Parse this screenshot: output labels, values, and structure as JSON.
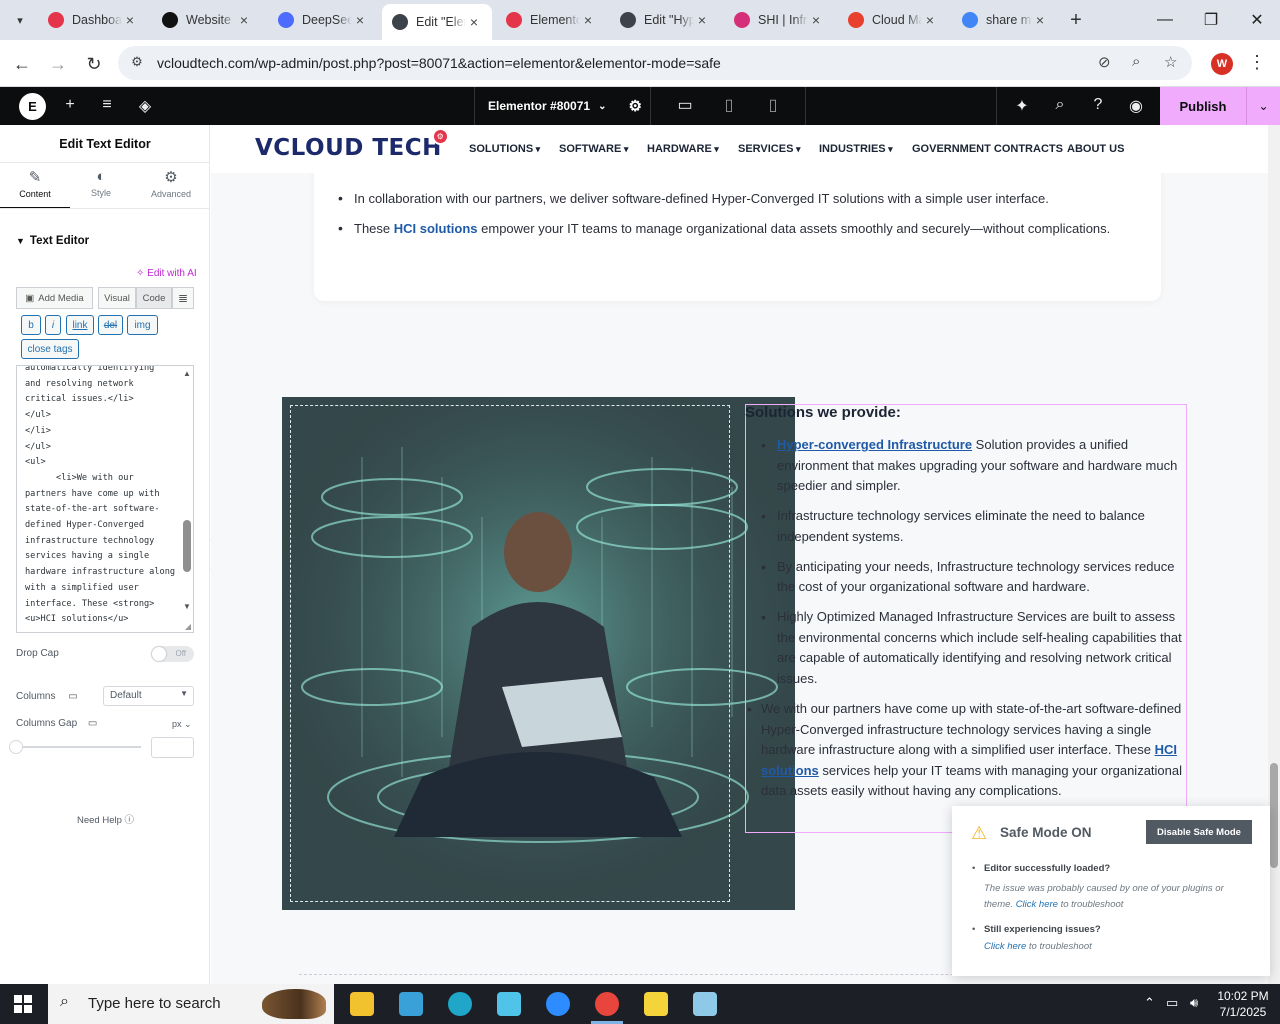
{
  "browser": {
    "tabs": [
      {
        "label": "Dashboard",
        "icon": "gear-red-icon",
        "color": "#e4354b",
        "active": false
      },
      {
        "label": "Website",
        "icon": "openai-icon",
        "color": "#111111",
        "active": false
      },
      {
        "label": "DeepSeek",
        "icon": "deepseek-icon",
        "color": "#4d6bfe",
        "active": false
      },
      {
        "label": "Edit \"Elementor",
        "icon": "wordpress-icon",
        "color": "#3c434a",
        "active": true
      },
      {
        "label": "Elementor",
        "icon": "gear-red-icon",
        "color": "#e4354b",
        "active": false
      },
      {
        "label": "Edit \"Hyper",
        "icon": "wordpress-icon",
        "color": "#3c434a",
        "active": false
      },
      {
        "label": "SHI | Infrastructure",
        "icon": "shi-icon",
        "color": "#d62f7a",
        "active": false
      },
      {
        "label": "Cloud Management",
        "icon": "cloud-icon",
        "color": "#e8402f",
        "active": false
      },
      {
        "label": "share my",
        "icon": "google-icon",
        "color": "#4285f4",
        "active": false
      }
    ],
    "url": "vcloudtech.com/wp-admin/post.php?post=80071&action=elementor&elementor-mode=safe",
    "profile_initial": "W"
  },
  "elementor_bar": {
    "document_name": "Elementor #80071",
    "publish_label": "Publish"
  },
  "panel": {
    "title": "Edit Text Editor",
    "tabs": [
      {
        "label": "Content",
        "icon": "pencil-icon"
      },
      {
        "label": "Style",
        "icon": "half-circle-icon"
      },
      {
        "label": "Advanced",
        "icon": "gear-icon"
      }
    ],
    "section_title": "Text Editor",
    "edit_with_ai": "Edit with AI",
    "add_media": "Add Media",
    "visual_tab": "Visual",
    "code_tab": "Code",
    "quicktags": [
      "b",
      "i",
      "link",
      "del",
      "img"
    ],
    "close_tags": "close tags",
    "code_content": "automatically identifying\nand resolving network\ncritical issues.</li>\n</ul>\n</li>\n</ul>\n<ul>\n      <li>We with our partners have come up with state-of-the-art software-defined Hyper-Converged infrastructure technology services having a single hardware infrastructure along with a simplified user interface. These <strong> <u>HCI solutions</u>",
    "drop_cap_label": "Drop Cap",
    "drop_cap_value": "Off",
    "columns_label": "Columns",
    "columns_value": "Default",
    "columns_gap_label": "Columns Gap",
    "columns_gap_unit": "px",
    "need_help": "Need Help"
  },
  "site": {
    "logo_text": "VCLOUD TECH",
    "nav": [
      {
        "label": "SOLUTIONS",
        "dropdown": true
      },
      {
        "label": "SOFTWARE",
        "dropdown": true
      },
      {
        "label": "HARDWARE",
        "dropdown": true
      },
      {
        "label": "SERVICES",
        "dropdown": true
      },
      {
        "label": "INDUSTRIES",
        "dropdown": true
      },
      {
        "label": "GOVERNMENT CONTRACTS",
        "dropdown": false
      },
      {
        "label": "ABOUT US",
        "dropdown": false
      }
    ],
    "card_items": [
      {
        "pre": "In collaboration with our partners, we deliver software-defined Hyper-Converged IT solutions with a simple user interface.",
        "link": "",
        "post": ""
      },
      {
        "pre": "These ",
        "link": "HCI solutions",
        "post": " empower your IT teams to manage organizational data assets smoothly and securely—without complications."
      }
    ],
    "solutions_title": "Solutions we provide:",
    "solutions": [
      {
        "link": "Hyper-converged Infrastructure",
        "text": " Solution provides a unified environment that makes upgrading your software and hardware much speedier and simpler."
      },
      {
        "link": "",
        "text": "Infrastructure technology services eliminate the need to balance independent systems."
      },
      {
        "link": "",
        "text": "By anticipating your needs, Infrastructure technology services reduce the cost of your organizational software and hardware."
      },
      {
        "link": "",
        "text": "Highly Optimized Managed Infrastructure Services are built to assess the environmental concerns which include self-healing capabilities that are capable of automatically identifying and resolving network critical issues."
      }
    ],
    "outer_item": {
      "pre": "We with our partners have come up with state-of-the-art software-defined Hyper-Converged infrastructure technology services having a single hardware infrastructure along with a simplified user interface. These ",
      "link": "HCI solutions",
      "post": " services help your IT teams with managing your organizational data assets easily without having any complications."
    }
  },
  "safe_mode": {
    "title": "Safe Mode ON",
    "button": "Disable Safe Mode",
    "item1_title": "Editor successfully loaded?",
    "item1_text": "The issue was probably caused by one of your plugins or theme.",
    "item1_link": "Click here",
    "item1_suffix": " to troubleshoot",
    "item2_title": "Still experiencing issues?",
    "item2_link": "Click here",
    "item2_suffix": " to troubleshoot"
  },
  "taskbar": {
    "search_placeholder": "Type here to search",
    "apps": [
      {
        "name": "file-explorer-icon",
        "color": "#f2c12e"
      },
      {
        "name": "snipping-tool-icon",
        "color": "#3aa0d8"
      },
      {
        "name": "edge-icon",
        "color": "#1fa6c9"
      },
      {
        "name": "app-diamond-icon",
        "color": "#4fc3e8"
      },
      {
        "name": "zoom-icon",
        "color": "#2d8cff"
      },
      {
        "name": "chrome-icon",
        "color": "#e8453c"
      },
      {
        "name": "sticky-notes-icon",
        "color": "#f5d33a"
      },
      {
        "name": "notepad-icon",
        "color": "#8fc9e8"
      }
    ],
    "time": "10:02 PM",
    "date": "7/1/2025"
  },
  "colors": {
    "accent": "#f0abfc",
    "brand_navy": "#1c2a6b",
    "link_blue": "#1f5aa8"
  }
}
